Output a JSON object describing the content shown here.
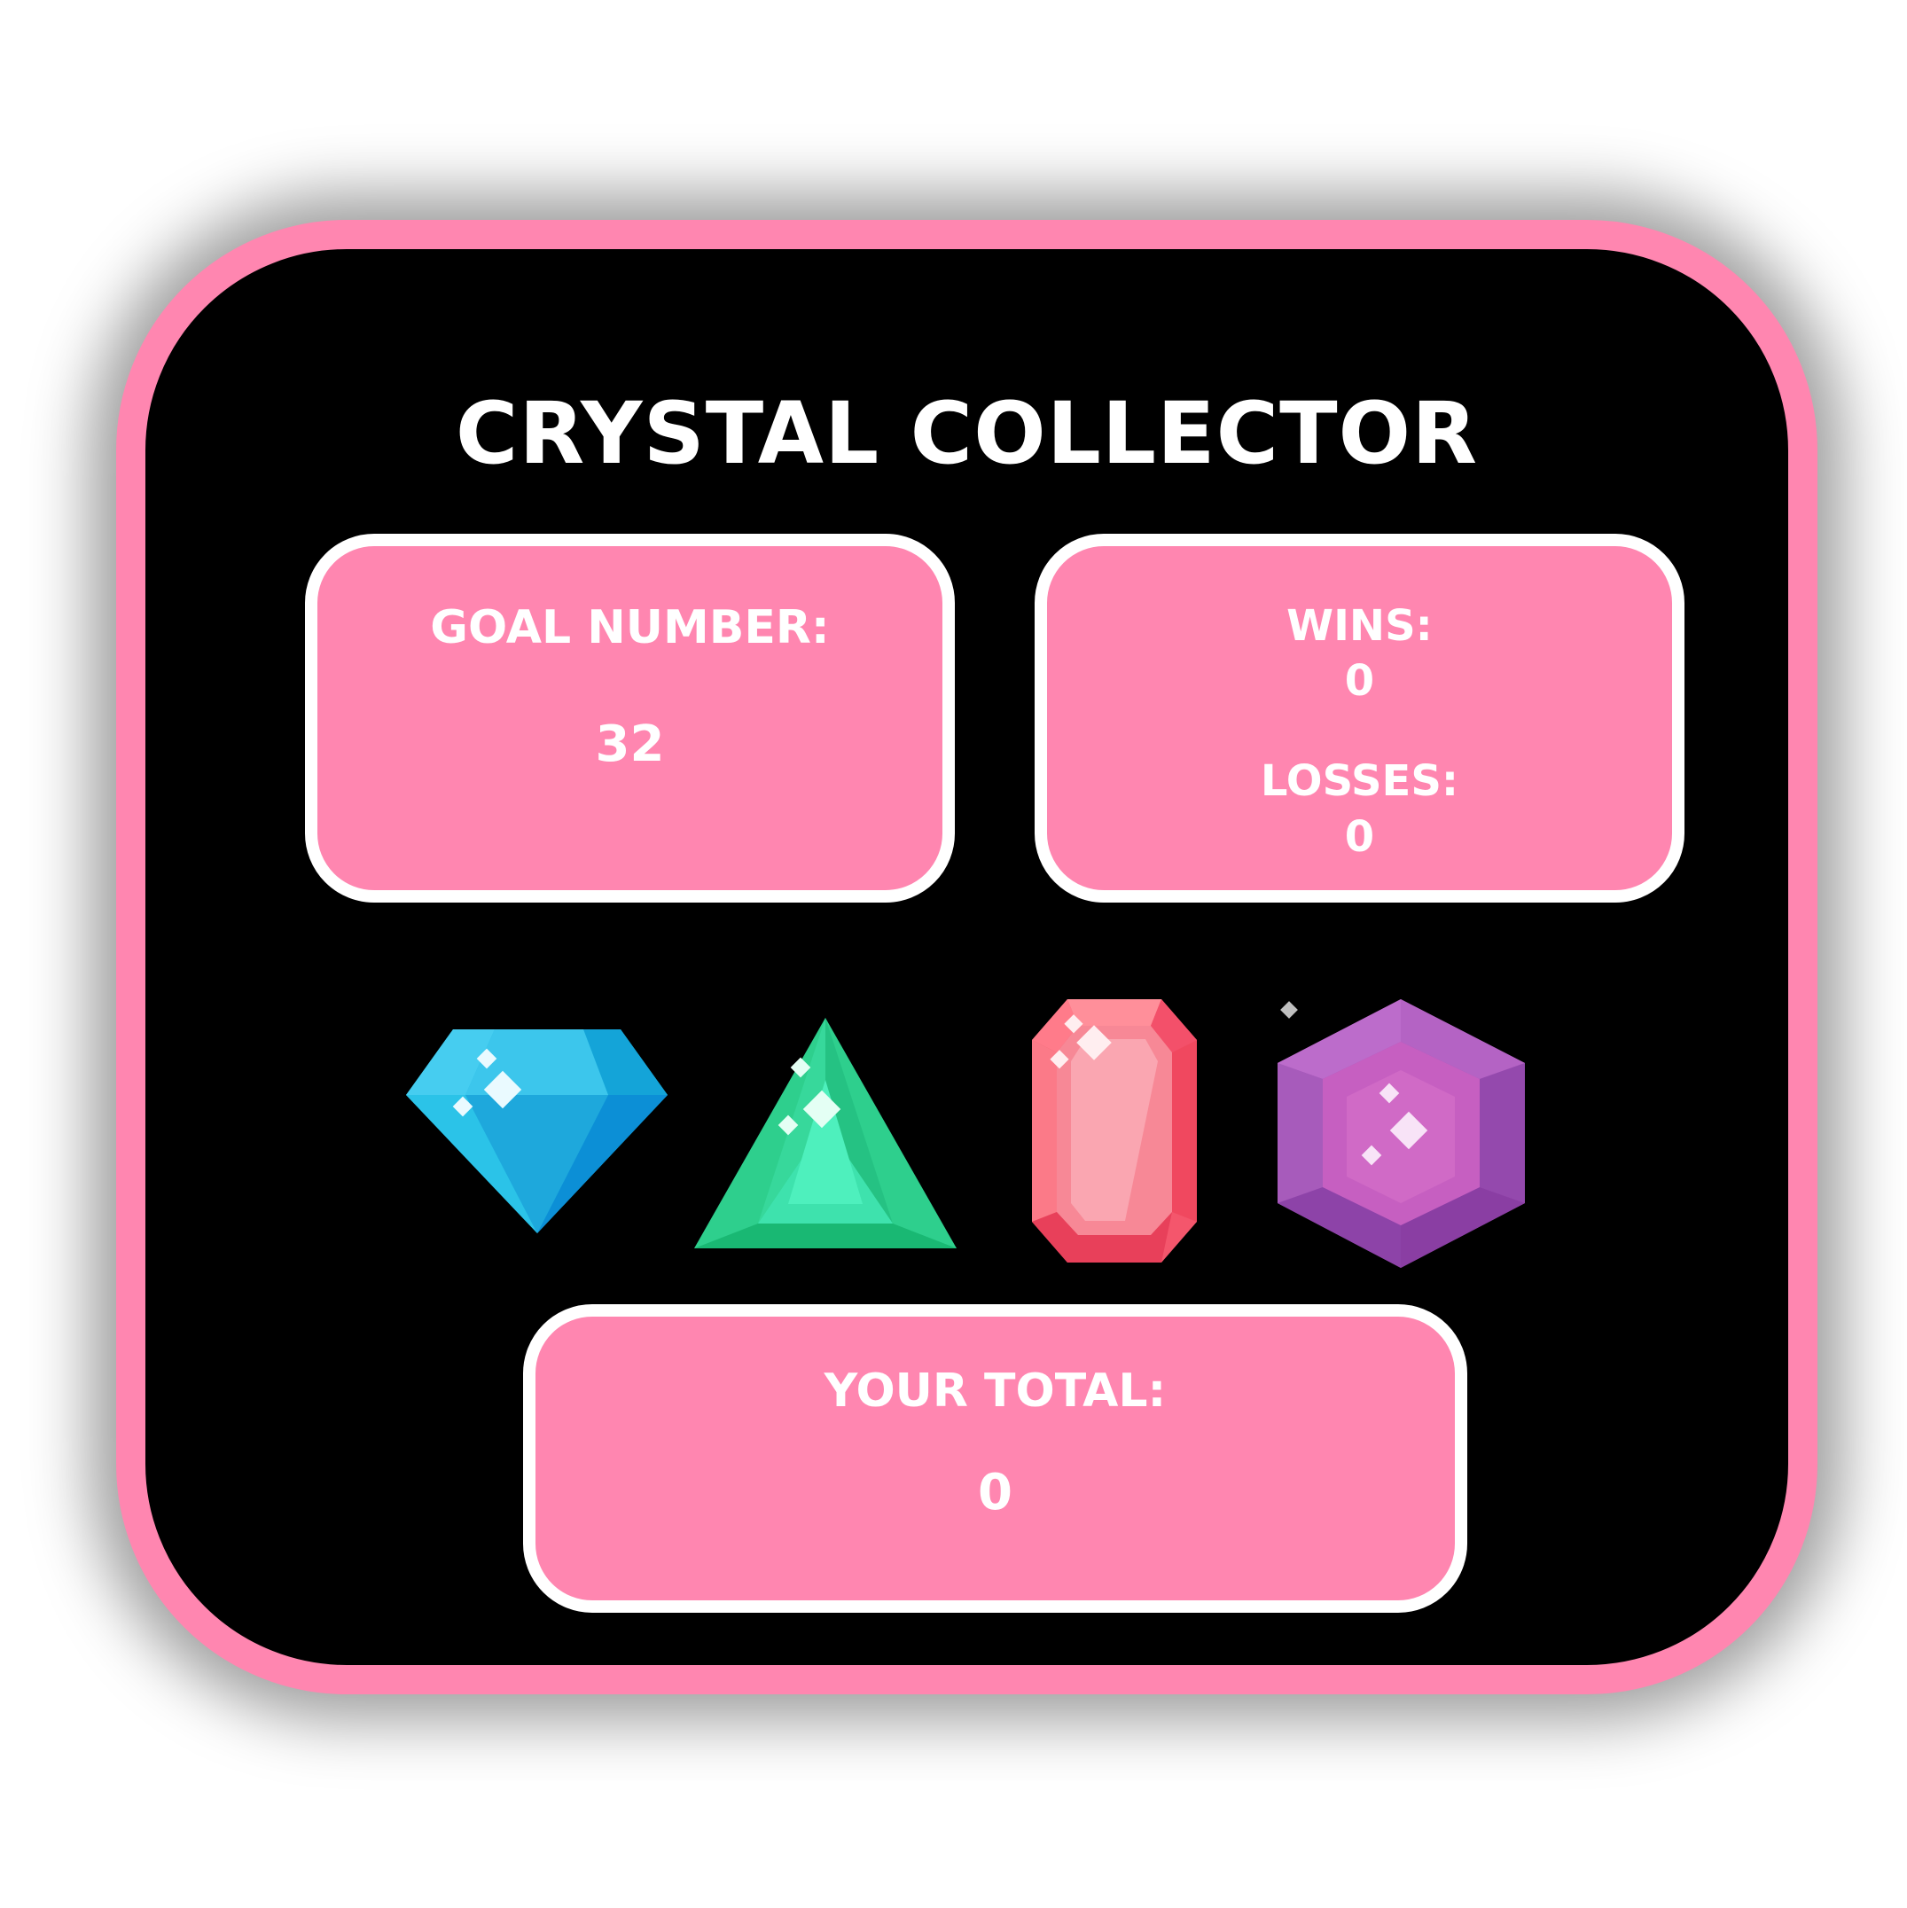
{
  "game": {
    "title": "CRYSTAL COLLECTOR",
    "goal": {
      "label": "GOAL NUMBER:",
      "value": "32"
    },
    "record": {
      "wins_label": "WINS:",
      "wins_value": "0",
      "losses_label": "LOSSES:",
      "losses_value": "0"
    },
    "total": {
      "label": "YOUR TOTAL:",
      "value": "0"
    },
    "crystals": [
      {
        "name": "blue-diamond-crystal",
        "color": "#1fb7e0"
      },
      {
        "name": "green-triangle-crystal",
        "color": "#2ecf8d"
      },
      {
        "name": "red-octagon-crystal",
        "color": "#f4566c"
      },
      {
        "name": "purple-hexagon-crystal",
        "color": "#a252b8"
      }
    ],
    "colors": {
      "frame_border": "#ff86b0",
      "frame_background": "#000000",
      "panel_background": "#ff86b0",
      "panel_border": "#ffffff",
      "text": "#ffffff"
    }
  }
}
